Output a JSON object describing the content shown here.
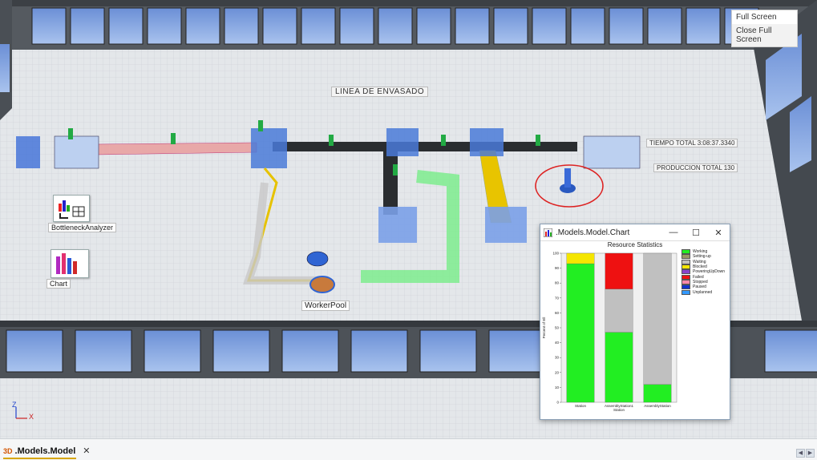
{
  "overlay_menu": {
    "items": [
      "Full Screen",
      "Close Full Screen"
    ]
  },
  "scene": {
    "line_title": "LINEA DE ENVASADO",
    "total_time": "TIEMPO TOTAL 3:08:37.3340",
    "production_total": "PRODUCCION TOTAL 130",
    "bottleneck_label": "BottleneckAnalyzer",
    "chart_label": "Chart",
    "workerpool_label": "WorkerPool",
    "axis": {
      "z": "Z",
      "x": "X"
    }
  },
  "chart_window": {
    "title": ".Models.Model.Chart",
    "minimize": "—",
    "maximize": "☐",
    "close": "✕"
  },
  "chart_data": {
    "type": "bar",
    "title": "Resource Statistics",
    "ylabel": "Percent of Ell",
    "ylim": [
      0,
      100
    ],
    "yticks": [
      0,
      10,
      20,
      30,
      40,
      50,
      60,
      70,
      80,
      90,
      100
    ],
    "categories": [
      "Station",
      "AssemblyStation1 Station",
      "AssemblyStation"
    ],
    "stacked": true,
    "series": [
      {
        "name": "Working",
        "color": "#22ee22",
        "values": [
          93,
          47,
          12
        ]
      },
      {
        "name": "Setting-up",
        "color": "#999966",
        "values": [
          0,
          0,
          0
        ]
      },
      {
        "name": "Waiting",
        "color": "#c0c0c0",
        "values": [
          0,
          29,
          88
        ]
      },
      {
        "name": "Blocked",
        "color": "#f5e600",
        "values": [
          7,
          0,
          0
        ]
      },
      {
        "name": "PoweringUpDown",
        "color": "#8844cc",
        "values": [
          0,
          0,
          0
        ]
      },
      {
        "name": "Failed",
        "color": "#ee1111",
        "values": [
          0,
          24,
          0
        ]
      },
      {
        "name": "Stopped",
        "color": "#ff88aa",
        "values": [
          0,
          0,
          0
        ]
      },
      {
        "name": "Paused",
        "color": "#1133cc",
        "values": [
          0,
          0,
          0
        ]
      },
      {
        "name": "Unplanned",
        "color": "#3399ff",
        "values": [
          0,
          0,
          0
        ]
      }
    ],
    "legend_position": "right",
    "grid": false
  },
  "tabbar": {
    "tab_icon": "3D",
    "tab_label": ".Models.Model",
    "tab_close": "✕",
    "nav_left": "◀",
    "nav_right": "▶"
  }
}
